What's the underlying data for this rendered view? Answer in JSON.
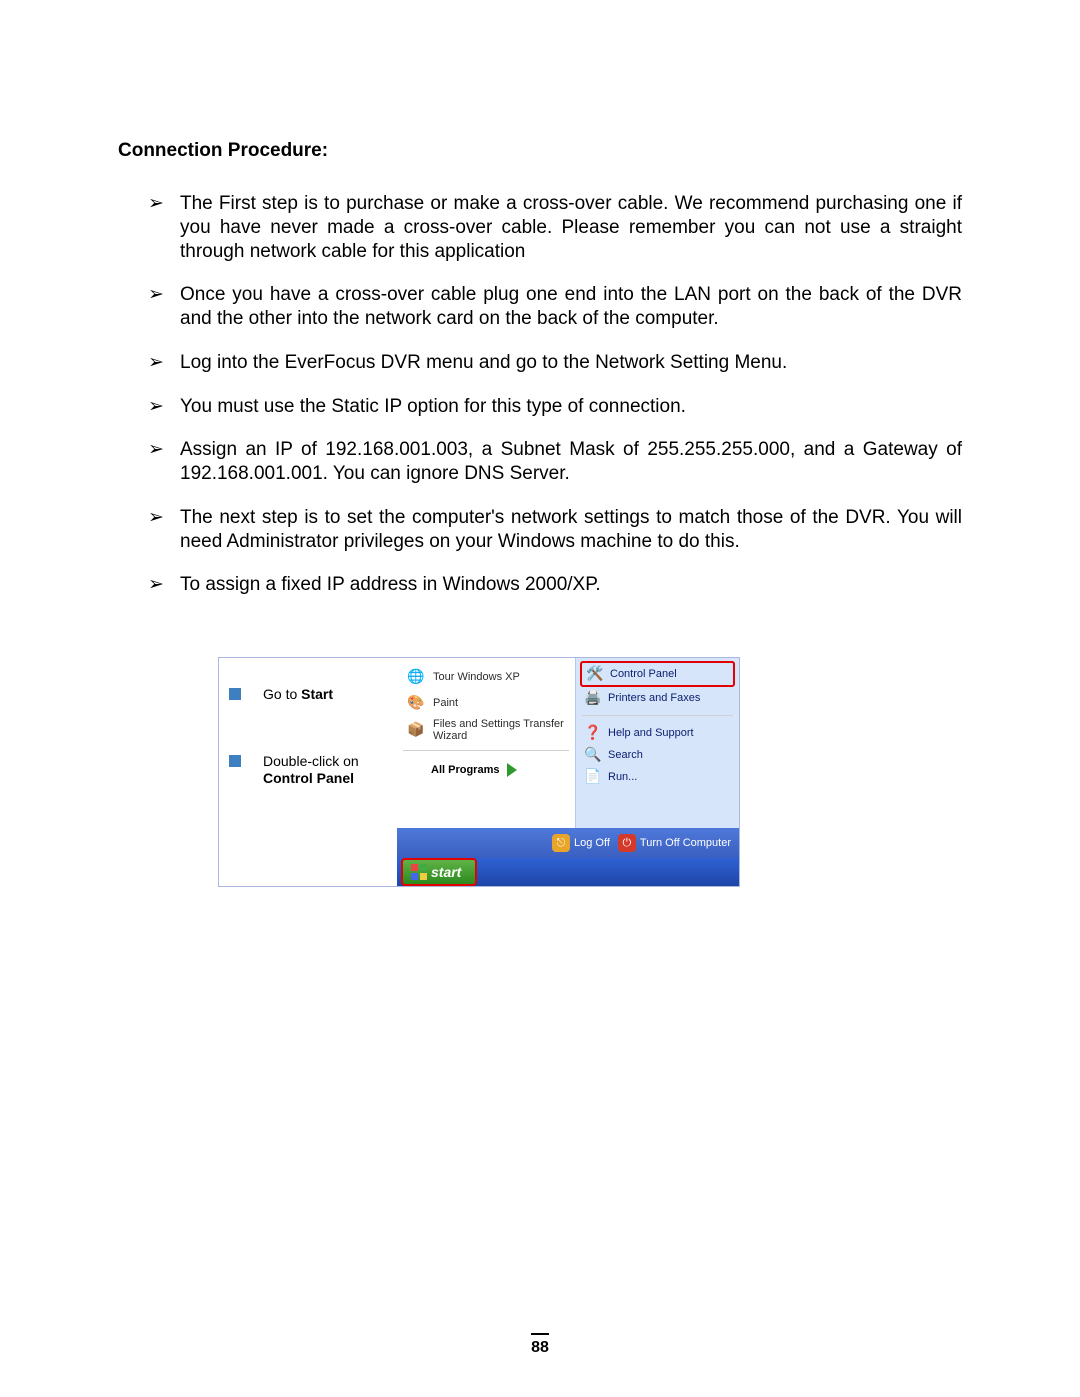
{
  "heading": "Connection Procedure:",
  "bullets": [
    "The First step is to purchase or make a cross-over cable. We recommend purchasing one if you have never made a cross-over cable. Please remember you can not use a straight through network cable for this application",
    "Once you have a cross-over cable plug one end into the LAN port on the back of the DVR and the other into the network card on the back of the computer.",
    "Log into the EverFocus DVR menu and go to the Network Setting Menu.",
    "You must use the Static IP option for this type of connection.",
    "Assign an IP of 192.168.001.003, a Subnet Mask of 255.255.255.000, and a Gateway of 192.168.001.001. You can ignore DNS Server.",
    "The next step is to set the computer's network settings to match those of the DVR. You will need Administrator privileges on your Windows machine to do this.",
    "To assign a fixed IP address in Windows 2000/XP."
  ],
  "instructions": {
    "step1_prefix": "Go to ",
    "step1_bold": "Start",
    "step2_line1": "Double-click on",
    "step2_line2": "Control Panel"
  },
  "start_menu": {
    "left": {
      "tour": "Tour Windows XP",
      "paint": "Paint",
      "wizard": "Files and Settings Transfer Wizard",
      "all_programs": "All Programs"
    },
    "right": {
      "control_panel": "Control Panel",
      "printers": "Printers and Faxes",
      "help": "Help and Support",
      "search": "Search",
      "run": "Run..."
    },
    "footer": {
      "logoff": "Log Off",
      "turnoff": "Turn Off Computer"
    },
    "taskbar": {
      "start": "start"
    }
  },
  "page_number": "88"
}
